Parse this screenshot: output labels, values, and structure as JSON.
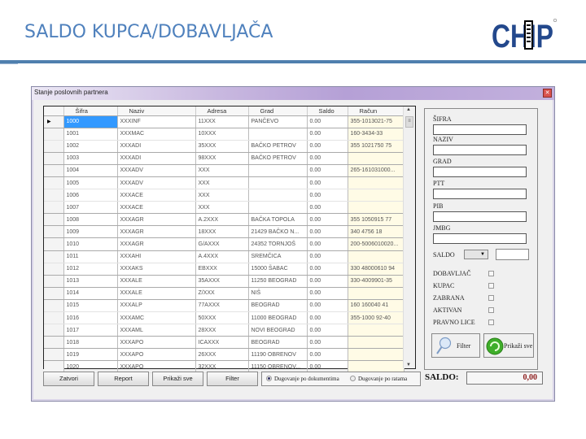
{
  "slide": {
    "title": "SALDO KUPCA/DOBAVLJAČA",
    "logo_text": "CHIP",
    "accent_color": "#4f81bd"
  },
  "window": {
    "title": "Stanje poslovnih partnera",
    "close_icon": "close-icon"
  },
  "grid": {
    "columns": [
      "Šifra",
      "Naziv",
      "Adresa",
      "Grad",
      "Saldo",
      "Račun"
    ],
    "rows": [
      [
        "1000",
        "XXXINF",
        "11XXX",
        "PANČEVO",
        "0.00",
        "355-1013021-75"
      ],
      [
        "1001",
        "XXXMAC",
        "10XXX",
        "",
        "0.00",
        "160-3434-33"
      ],
      [
        "1002",
        "XXXADI",
        "35XXX",
        "BAČKO PETROV",
        "0.00",
        "355 1021750 75"
      ],
      [
        "1003",
        "XXXADI",
        "98XXX",
        "BAČKO PETROV",
        "0.00",
        ""
      ],
      [
        "1004",
        "XXXADV",
        "XXX",
        "",
        "0.00",
        "265-161031000..."
      ],
      [
        "1005",
        "XXXADV",
        "XXX",
        "",
        "0.00",
        ""
      ],
      [
        "1006",
        "XXXACE",
        "XXX",
        "",
        "0.00",
        ""
      ],
      [
        "1007",
        "XXXACE",
        "XXX",
        "",
        "0.00",
        ""
      ],
      [
        "1008",
        "XXXAGR",
        "A.2XXX",
        "BAČKA TOPOLA",
        "0.00",
        "355 1050915 77"
      ],
      [
        "1009",
        "XXXAGR",
        "18XXX",
        "21429 BAČKO N...",
        "0.00",
        "340 4756 18"
      ],
      [
        "1010",
        "XXXAGR",
        "G/AXXX",
        "24352 TORNJOŠ",
        "0.00",
        "200-5006010020..."
      ],
      [
        "1011",
        "XXXAHI",
        "A.4XXX",
        "SREMČICA",
        "0.00",
        ""
      ],
      [
        "1012",
        "XXXAKS",
        "EBXXX",
        "15000 ŠABAC",
        "0.00",
        "330 48000610 94"
      ],
      [
        "1013",
        "XXXALE",
        "35AXXX",
        "11250 BEOGRAD",
        "0.00",
        "330-4009901-35"
      ],
      [
        "1014",
        "XXXALE",
        "Z/XXX",
        "NIŠ",
        "0.00",
        ""
      ],
      [
        "1015",
        "XXXALP",
        "77AXXX",
        "BEOGRAD",
        "0.00",
        "160 160040 41"
      ],
      [
        "1016",
        "XXXAMC",
        "50XXX",
        "11000 BEOGRAD",
        "0.00",
        "355-1000 92-40"
      ],
      [
        "1017",
        "XXXAML",
        "28XXX",
        "NOVI BEOGRAD",
        "0.00",
        ""
      ],
      [
        "1018",
        "XXXAPO",
        "ICAXXX",
        "BEOGRAD",
        "0.00",
        ""
      ],
      [
        "1019",
        "XXXAPO",
        "26XXX",
        "11190 OBRENOV",
        "0.00",
        ""
      ],
      [
        "1020",
        "XXXAPO",
        "32XXX",
        "11150 OBRENOV...",
        "0.00",
        ""
      ]
    ],
    "selected_row": 0
  },
  "filter_panel": {
    "fields": [
      {
        "label": "ŠIFRA",
        "value": ""
      },
      {
        "label": "NAZIV",
        "value": ""
      },
      {
        "label": "GRAD",
        "value": ""
      },
      {
        "label": "PTT",
        "value": ""
      },
      {
        "label": "PIB",
        "value": ""
      },
      {
        "label": "JMBG",
        "value": ""
      }
    ],
    "saldo_label": "SALDO",
    "saldo_combo_value": "",
    "saldo_value": "",
    "checkboxes": [
      {
        "label": "DOBAVLJAČ",
        "checked": false
      },
      {
        "label": "KUPAC",
        "checked": false
      },
      {
        "label": "ZABRANA",
        "checked": false
      },
      {
        "label": "AKTIVAN",
        "checked": false
      },
      {
        "label": "PRAVNO LICE",
        "checked": false
      }
    ],
    "filter_button": "Filter",
    "show_all_button": "Prikaži sve"
  },
  "bottom": {
    "buttons": [
      "Zatvori",
      "Report",
      "Prikaži sve",
      "Filter"
    ],
    "radios": [
      {
        "label": "Dugovanje po dokumentima",
        "selected": true
      },
      {
        "label": "Dugovanje po ratama",
        "selected": false
      }
    ],
    "saldo_label": "SALDO:",
    "saldo_value": "0,00"
  }
}
